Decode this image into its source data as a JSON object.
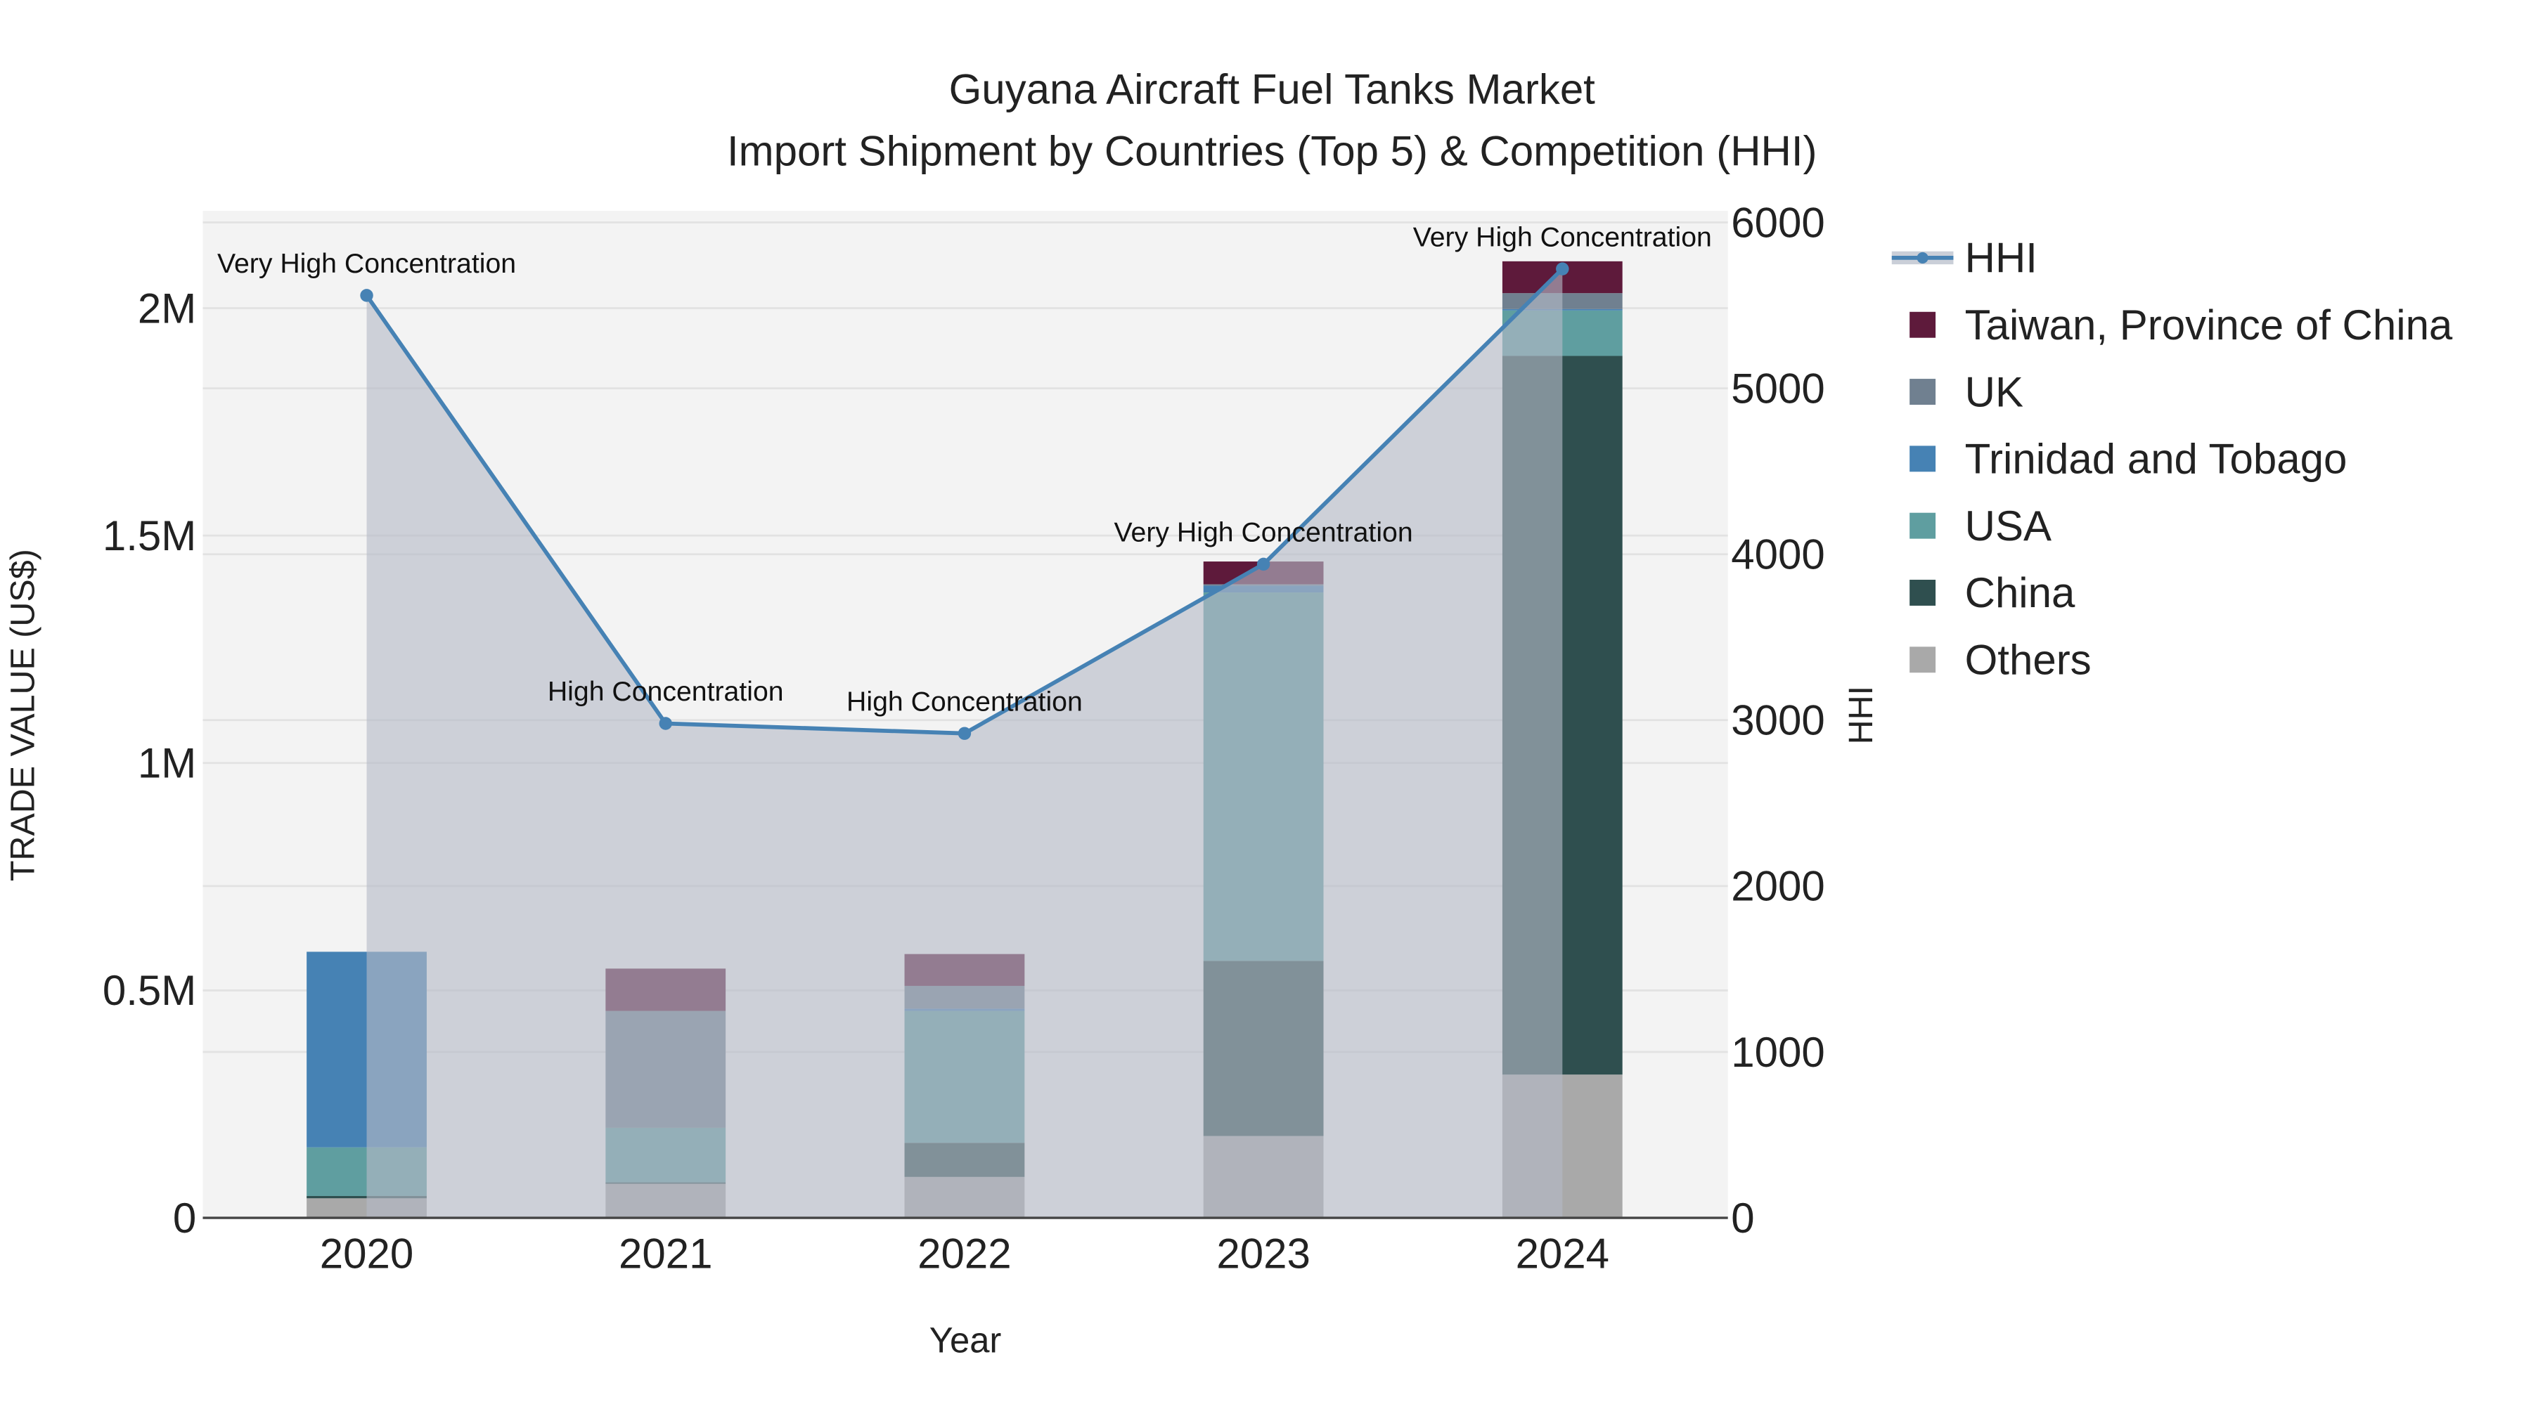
{
  "chart_data": {
    "type": "bar",
    "stacked": true,
    "title": "Guyana Aircraft Fuel Tanks Market",
    "subtitle": "Import Shipment by Countries (Top 5) & Competition (HHI)",
    "xlabel": "Year",
    "ylabel": "TRADE VALUE (US$)",
    "y2label": "HHI",
    "categories": [
      "2020",
      "2021",
      "2022",
      "2023",
      "2024"
    ],
    "ylim": [
      0,
      2214000
    ],
    "y2lim": [
      0,
      6070
    ],
    "yticks": [
      {
        "v": 0,
        "label": "0"
      },
      {
        "v": 500000,
        "label": "0.5M"
      },
      {
        "v": 1000000,
        "label": "1M"
      },
      {
        "v": 1500000,
        "label": "1.5M"
      },
      {
        "v": 2000000,
        "label": "2M"
      }
    ],
    "y2ticks": [
      {
        "v": 0,
        "label": "0"
      },
      {
        "v": 1000,
        "label": "1000"
      },
      {
        "v": 2000,
        "label": "2000"
      },
      {
        "v": 3000,
        "label": "3000"
      },
      {
        "v": 4000,
        "label": "4000"
      },
      {
        "v": 5000,
        "label": "5000"
      },
      {
        "v": 6000,
        "label": "6000"
      }
    ],
    "series": [
      {
        "name": "Others",
        "color": "#a9a9a9",
        "values": [
          43000,
          75000,
          90000,
          180000,
          315000
        ]
      },
      {
        "name": "China",
        "color": "#2f4f4f",
        "values": [
          5000,
          3000,
          75000,
          385000,
          1580000
        ]
      },
      {
        "name": "USA",
        "color": "#5f9ea0",
        "values": [
          107000,
          120000,
          290000,
          810000,
          100000
        ]
      },
      {
        "name": "Trinidad and Tobago",
        "color": "#4682b4",
        "values": [
          430000,
          0,
          5000,
          15000,
          3000
        ]
      },
      {
        "name": "UK",
        "color": "#708090",
        "values": [
          0,
          257000,
          50000,
          3000,
          35000
        ]
      },
      {
        "name": "Taiwan, Province of China",
        "color": "#5e1a3b",
        "values": [
          0,
          93000,
          70000,
          50000,
          70000
        ]
      }
    ],
    "hhi": {
      "name": "HHI",
      "color": "#4682b4",
      "values": [
        5560,
        2980,
        2920,
        3940,
        5720
      ],
      "annotations": [
        "Very High Concentration",
        "High Concentration",
        "High Concentration",
        "Very High Concentration",
        "Very High Concentration"
      ]
    },
    "legend": {
      "position": "right",
      "items": [
        "HHI",
        "Taiwan, Province of China",
        "UK",
        "Trinidad and Tobago",
        "USA",
        "China",
        "Others"
      ]
    },
    "grid": true
  }
}
